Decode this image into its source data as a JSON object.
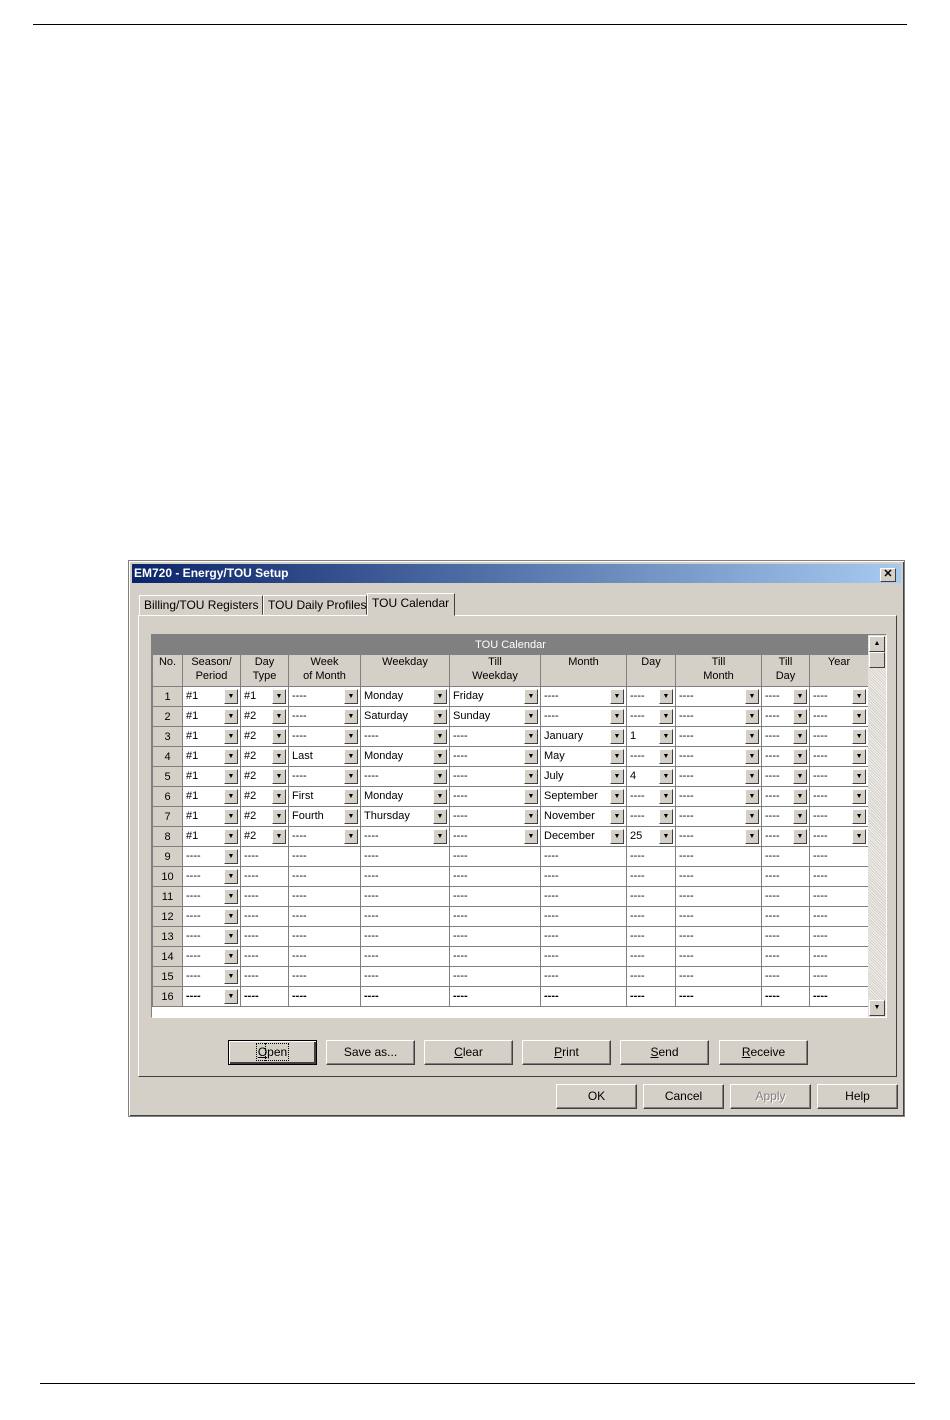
{
  "window": {
    "title": "EM720 - Energy/TOU Setup",
    "close_glyph": "✕"
  },
  "tabs": [
    {
      "label": "Billing/TOU Registers"
    },
    {
      "label": "TOU Daily Profiles"
    },
    {
      "label": "TOU Calendar"
    }
  ],
  "table": {
    "title": "TOU Calendar",
    "columns": [
      {
        "line1": "No.",
        "line2": ""
      },
      {
        "line1": "Season/",
        "line2": "Period"
      },
      {
        "line1": "Day",
        "line2": "Type"
      },
      {
        "line1": "Week",
        "line2": "of Month"
      },
      {
        "line1": "Weekday",
        "line2": ""
      },
      {
        "line1": "Till",
        "line2": "Weekday"
      },
      {
        "line1": "Month",
        "line2": ""
      },
      {
        "line1": "Day",
        "line2": ""
      },
      {
        "line1": "Till",
        "line2": "Month"
      },
      {
        "line1": "Till",
        "line2": "Day"
      },
      {
        "line1": "Year",
        "line2": ""
      }
    ],
    "rows": [
      {
        "no": "1",
        "cells": [
          "#1",
          "#1",
          "----",
          "Monday",
          "Friday",
          "----",
          "----",
          "----",
          "----",
          "----"
        ]
      },
      {
        "no": "2",
        "cells": [
          "#1",
          "#2",
          "----",
          "Saturday",
          "Sunday",
          "----",
          "----",
          "----",
          "----",
          "----"
        ]
      },
      {
        "no": "3",
        "cells": [
          "#1",
          "#2",
          "----",
          "----",
          "----",
          "January",
          "1",
          "----",
          "----",
          "----"
        ]
      },
      {
        "no": "4",
        "cells": [
          "#1",
          "#2",
          "Last",
          "Monday",
          "----",
          "May",
          "----",
          "----",
          "----",
          "----"
        ]
      },
      {
        "no": "5",
        "cells": [
          "#1",
          "#2",
          "----",
          "----",
          "----",
          "July",
          "4",
          "----",
          "----",
          "----"
        ]
      },
      {
        "no": "6",
        "cells": [
          "#1",
          "#2",
          "First",
          "Monday",
          "----",
          "September",
          "----",
          "----",
          "----",
          "----"
        ]
      },
      {
        "no": "7",
        "cells": [
          "#1",
          "#2",
          "Fourth",
          "Thursday",
          "----",
          "November",
          "----",
          "----",
          "----",
          "----"
        ]
      },
      {
        "no": "8",
        "cells": [
          "#1",
          "#2",
          "----",
          "----",
          "----",
          "December",
          "25",
          "----",
          "----",
          "----"
        ]
      },
      {
        "no": "9",
        "cells": [
          "----",
          "----",
          "----",
          "----",
          "----",
          "----",
          "----",
          "----",
          "----",
          "----"
        ]
      },
      {
        "no": "10",
        "cells": [
          "----",
          "----",
          "----",
          "----",
          "----",
          "----",
          "----",
          "----",
          "----",
          "----"
        ]
      },
      {
        "no": "11",
        "cells": [
          "----",
          "----",
          "----",
          "----",
          "----",
          "----",
          "----",
          "----",
          "----",
          "----"
        ]
      },
      {
        "no": "12",
        "cells": [
          "----",
          "----",
          "----",
          "----",
          "----",
          "----",
          "----",
          "----",
          "----",
          "----"
        ]
      },
      {
        "no": "13",
        "cells": [
          "----",
          "----",
          "----",
          "----",
          "----",
          "----",
          "----",
          "----",
          "----",
          "----"
        ]
      },
      {
        "no": "14",
        "cells": [
          "----",
          "----",
          "----",
          "----",
          "----",
          "----",
          "----",
          "----",
          "----",
          "----"
        ]
      },
      {
        "no": "15",
        "cells": [
          "----",
          "----",
          "----",
          "----",
          "----",
          "----",
          "----",
          "----",
          "----",
          "----"
        ]
      },
      {
        "no": "16",
        "cells": [
          "----",
          "----",
          "----",
          "----",
          "----",
          "----",
          "----",
          "----",
          "----",
          "----"
        ]
      }
    ]
  },
  "action_buttons": [
    {
      "label": "Open",
      "mnemonic": "O",
      "rest": "pen",
      "name": "open-button"
    },
    {
      "label": "Save as...",
      "mnemonic": "",
      "rest": "",
      "name": "save-as-button"
    },
    {
      "label": "Clear",
      "mnemonic": "C",
      "rest": "lear",
      "name": "clear-button"
    },
    {
      "label": "Print",
      "mnemonic": "P",
      "rest": "rint",
      "name": "print-button"
    },
    {
      "label": "Send",
      "mnemonic": "S",
      "rest": "end",
      "name": "send-button"
    },
    {
      "label": "Receive",
      "mnemonic": "R",
      "rest": "eceive",
      "name": "receive-button"
    }
  ],
  "dialog_buttons": [
    {
      "label": "OK",
      "name": "ok-button",
      "enabled": true
    },
    {
      "label": "Cancel",
      "name": "cancel-button",
      "enabled": true
    },
    {
      "label": "Apply",
      "name": "apply-button",
      "enabled": false
    },
    {
      "label": "Help",
      "name": "help-button",
      "enabled": true
    }
  ],
  "icons": {
    "dropdown": "dropdown-arrow-icon",
    "scroll_up": "scroll-up-arrow-icon",
    "scroll_down": "scroll-down-arrow-icon",
    "close": "close-icon"
  },
  "colors": {
    "titlebar_start": "#0a246a",
    "titlebar_end": "#a6caf0",
    "dialog_face": "#d4d0c8",
    "table_caption_bg": "#808080"
  }
}
